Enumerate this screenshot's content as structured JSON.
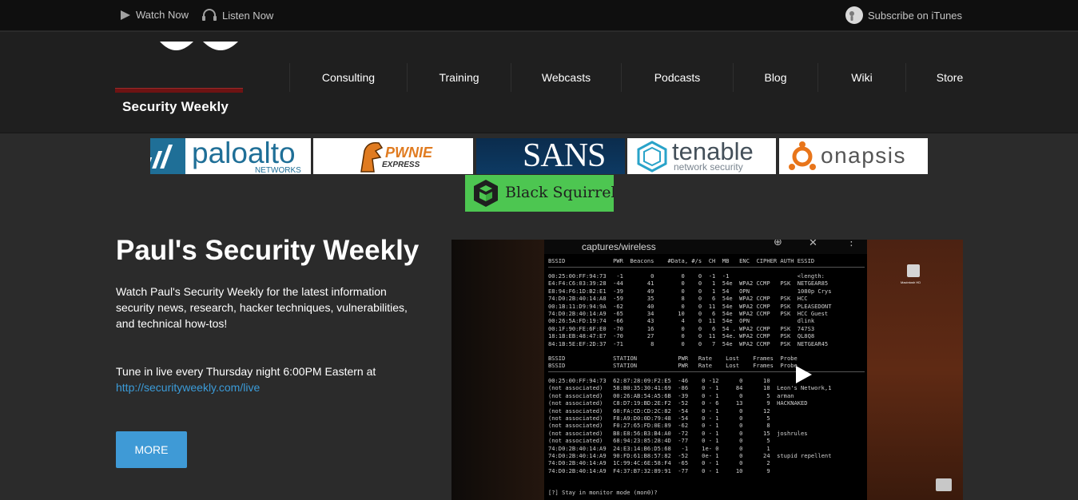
{
  "topbar": {
    "watch_label": "Watch Now",
    "listen_label": "Listen Now",
    "itunes_label": "Subscribe on iTunes"
  },
  "logo": {
    "name": "Security Weekly"
  },
  "nav": {
    "items": [
      {
        "label": "Consulting"
      },
      {
        "label": "Training"
      },
      {
        "label": "Webcasts"
      },
      {
        "label": "Podcasts"
      },
      {
        "label": "Blog"
      },
      {
        "label": "Wiki"
      },
      {
        "label": "Store"
      }
    ]
  },
  "sponsors": {
    "paloalto": {
      "name": "paloalto",
      "sub": "NETWORKS"
    },
    "pwnie": {
      "name": "PWNIE",
      "sub": "EXPRESS"
    },
    "sans": {
      "name": "SANS"
    },
    "tenable": {
      "name": "tenable",
      "sub": "network security"
    },
    "onapsis": {
      "name": "onapsis"
    },
    "blacksquirrel": {
      "name": "Black Squirrel"
    }
  },
  "hero": {
    "title": "Paul's Security Weekly",
    "description": "Watch Paul's Security Weekly for the latest information security news, research, hacker techniques, vulnerabilities, and technical how-tos!",
    "live_text": "Tune in live every Thursday night 6:00PM Eastern at",
    "live_url": "http://securityweekly.com/live",
    "more_label": "MORE"
  },
  "video": {
    "terminal_path": "captures/wireless",
    "desktop_hd_label": "Macintosh HD",
    "prompt_line": "[?] Stay in monitor mode (mon0)?",
    "ap_header": "BSSID              PWR  Beacons    #Data, #/s  CH  MB   ENC  CIPHER AUTH ESSID",
    "ap_rows": [
      "00:25:00:FF:94:73   -1        0        0    0  -1  -1                    <length:",
      "E4:F4:C6:03:39:28  -44       41        0    0   1  54e  WPA2 CCMP   PSK  NETGEAR85",
      "E8:94:F6:1D:B2:E1  -39       49        0    0   1  54   OPN              1080p Crys",
      "74:D0:2B:40:14:A8  -59       35        8    0   6  54e  WPA2 CCMP   PSK  HCC",
      "00:1B:11:D9:94:9A  -62       40        0    0  11  54e  WPA2 CCMP   PSK  PLEASEDONT",
      "74:D0:2B:40:14:A9  -65       34       10    0   6  54e  WPA2 CCMP   PSK  HCC Guest",
      "00:26:5A:FD:19:74  -66       43        4    0  11  54e  OPN              dlink",
      "00:1F:90:FE:6F:E0  -70       16        0    0   6  54 . WPA2 CCMP   PSK  747S3",
      "18:1B:EB:48:47:E7  -70       27        0    0  11  54e. WPA2 CCMP   PSK  QL8Q8",
      "84:1B:5E:EF:2D:37  -71        8        0    0   7  54e  WPA2 CCMP   PSK  NETGEAR45"
    ],
    "sta_header_1": "BSSID              STATION            PWR   Rate    Lost    Frames  Probe",
    "sta_header_2": "BSSID              STATION            PWR   Rate    Lost    Frames  Probe",
    "sta_rows": [
      "00:25:00:FF:94:73  62:87:28:09:F2:E5  -46    0 -12      0      10",
      "(not associated)   58:B0:35:30:41:69  -86    0 - 1     84      18  Leon's Network,1",
      "(not associated)   00:26:AB:54:A5:6B  -39    0 - 1      0       5  arman",
      "(not associated)   C8:D7:19:BD:2E:F2  -52    0 - 6     13       9  HACKNAKED",
      "(not associated)   60:FA:CD:CD:2C:82  -54    0 - 1      0      12",
      "(not associated)   F8:A9:D0:0D:79:48  -54    0 - 1      0       5",
      "(not associated)   F0:27:65:FD:0E:89  -62    0 - 1      0       8",
      "(not associated)   B8:E8:56:B3:B4:A0  -72    0 - 1      0      15  joshrules",
      "(not associated)   68:94:23:85:28:4D  -77    0 - 1      0       5",
      "74:D0:2B:40:14:A9  24:E3:14:B6:D5:68   -1    1e- 0      0       1",
      "74:D0:2B:40:14:A9  90:FD:61:B8:57:82  -52    0e- 1      0      24  stupid repellent",
      "74:D0:2B:40:14:A9  1C:99:4C:6E:58:F4  -65    0 - 1      0       2",
      "74:D0:2B:40:14:A9  F4:37:B7:32:89:91  -77    0 - 1     10       9"
    ]
  },
  "colors": {
    "accent": "#3f9ad6",
    "link": "#3b9bd8",
    "topbar_bg": "#0f0f0f",
    "header_bg": "#1f1f1f",
    "page_bg": "#2b2b2b",
    "logo_bar": "#6e1313",
    "squirrel_green": "#4dc651"
  }
}
